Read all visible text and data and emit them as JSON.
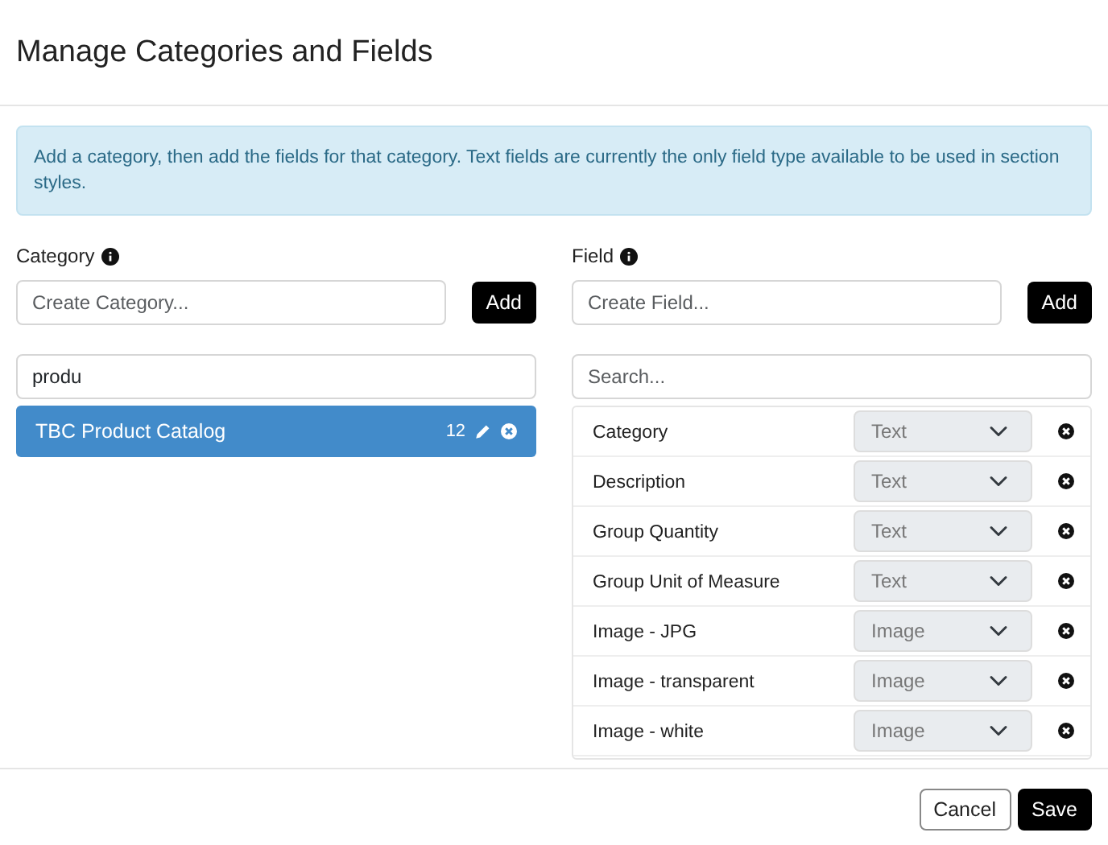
{
  "modal": {
    "title": "Manage Categories and Fields"
  },
  "alert": {
    "text": "Add a category, then add the fields for that category. Text fields are currently the only field type available to be used in section styles."
  },
  "category_panel": {
    "label": "Category",
    "create_placeholder": "Create Category...",
    "add_button": "Add",
    "search_value": "produ",
    "items": [
      {
        "name": "TBC Product Catalog",
        "count": "12",
        "selected": true
      }
    ]
  },
  "field_panel": {
    "label": "Field",
    "create_placeholder": "Create Field...",
    "add_button": "Add",
    "search_placeholder": "Search...",
    "fields": [
      {
        "name": "Category",
        "type": "Text",
        "disabled": true
      },
      {
        "name": "Description",
        "type": "Text",
        "disabled": true
      },
      {
        "name": "Group Quantity",
        "type": "Text",
        "disabled": true
      },
      {
        "name": "Group Unit of Measure",
        "type": "Text",
        "disabled": true
      },
      {
        "name": "Image - JPG",
        "type": "Image",
        "disabled": true
      },
      {
        "name": "Image - transparent",
        "type": "Image",
        "disabled": true
      },
      {
        "name": "Image - white",
        "type": "Image",
        "disabled": true
      }
    ]
  },
  "footer": {
    "buttons": [
      {
        "label": "Cancel",
        "kind": "secondary"
      },
      {
        "label": "Save",
        "kind": "primary"
      }
    ]
  }
}
